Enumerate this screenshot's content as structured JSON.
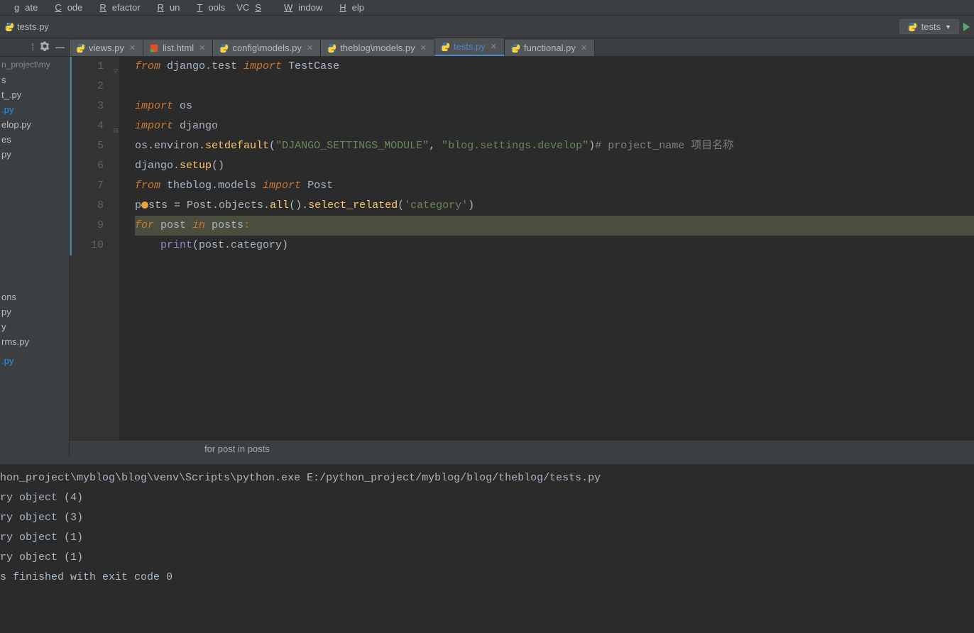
{
  "menu": {
    "items": [
      "gate",
      "Code",
      "Refactor",
      "Run",
      "Tools",
      "VCS",
      "Window",
      "Help"
    ],
    "underline_idx": [
      0,
      0,
      0,
      0,
      0,
      2,
      0,
      0
    ]
  },
  "nav": {
    "file": "tests.py",
    "run_config": "tests"
  },
  "sidebar": {
    "path": "n_project\\my",
    "items": [
      {
        "label": "s",
        "selected": false
      },
      {
        "label": "t_.py",
        "selected": false
      },
      {
        "label": ".py",
        "selected": true
      },
      {
        "label": "elop.py",
        "selected": false
      },
      {
        "label": "es",
        "selected": false
      },
      {
        "label": "py",
        "selected": false
      }
    ],
    "items2": [
      {
        "label": "ons",
        "selected": false
      },
      {
        "label": "py",
        "selected": false
      },
      {
        "label": "y",
        "selected": false
      },
      {
        "label": "rms.py",
        "selected": false
      },
      {
        "label": "",
        "selected": false
      },
      {
        "label": ".py",
        "selected": true
      }
    ]
  },
  "tabs": [
    {
      "label": "views.py",
      "type": "py",
      "active": false
    },
    {
      "label": "list.html",
      "type": "html",
      "active": false
    },
    {
      "label": "config\\models.py",
      "type": "py",
      "active": false
    },
    {
      "label": "theblog\\models.py",
      "type": "py",
      "active": false
    },
    {
      "label": "tests.py",
      "type": "py",
      "active": true
    },
    {
      "label": "functional.py",
      "type": "py",
      "active": false
    }
  ],
  "code": {
    "lines": [
      {
        "n": 1,
        "tokens": [
          [
            "kw-import",
            "from"
          ],
          [
            "default",
            " django.test "
          ],
          [
            "kw-import",
            "import"
          ],
          [
            "default",
            " TestCase"
          ]
        ]
      },
      {
        "n": 2,
        "tokens": []
      },
      {
        "n": 3,
        "tokens": [
          [
            "kw-import",
            "import"
          ],
          [
            "default",
            " os"
          ]
        ]
      },
      {
        "n": 4,
        "tokens": [
          [
            "kw-import",
            "import"
          ],
          [
            "default",
            " django"
          ]
        ]
      },
      {
        "n": 5,
        "tokens": [
          [
            "default",
            "os.environ."
          ],
          [
            "fn",
            "setdefault"
          ],
          [
            "default",
            "("
          ],
          [
            "str",
            "\"DJANGO_SETTINGS_MODULE\""
          ],
          [
            "default",
            ", "
          ],
          [
            "str",
            "\"blog.settings.develop\""
          ],
          [
            "default",
            ")"
          ],
          [
            "comment",
            "# project_name 项目名称"
          ]
        ]
      },
      {
        "n": 6,
        "tokens": [
          [
            "default",
            "django."
          ],
          [
            "fn",
            "setup"
          ],
          [
            "default",
            "()"
          ]
        ]
      },
      {
        "n": 7,
        "tokens": [
          [
            "kw-import",
            "from"
          ],
          [
            "default",
            " theblog.models "
          ],
          [
            "kw-import",
            "import"
          ],
          [
            "default",
            " Post"
          ]
        ]
      },
      {
        "n": 8,
        "tokens": [
          [
            "default",
            "p"
          ],
          [
            "warn",
            ""
          ],
          [
            "default",
            "sts = Post.objects."
          ],
          [
            "fn",
            "all"
          ],
          [
            "default",
            "()."
          ],
          [
            "fn",
            "select_related"
          ],
          [
            "default",
            "("
          ],
          [
            "str",
            "'category'"
          ],
          [
            "default",
            ")"
          ]
        ]
      },
      {
        "n": 9,
        "tokens": [
          [
            "kw-import",
            "for"
          ],
          [
            "default",
            " post "
          ],
          [
            "kw-import",
            "in"
          ],
          [
            "default",
            " posts"
          ],
          [
            "kw",
            ":"
          ]
        ],
        "hl": true
      },
      {
        "n": 10,
        "tokens": [
          [
            "default",
            "    "
          ],
          [
            "builtin",
            "print"
          ],
          [
            "default",
            "(post.category)"
          ]
        ]
      }
    ]
  },
  "breadcrumb": "for post in posts",
  "console": {
    "lines": [
      "hon_project\\myblog\\blog\\venv\\Scripts\\python.exe E:/python_project/myblog/blog/theblog/tests.py",
      "ry object (4)",
      "ry object (3)",
      "ry object (1)",
      "ry object (1)",
      "",
      "s finished with exit code 0"
    ]
  }
}
